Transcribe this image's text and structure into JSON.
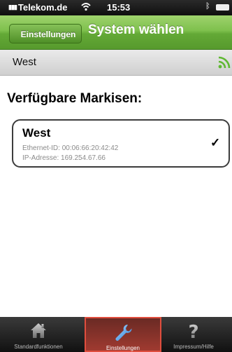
{
  "status_bar": {
    "carrier": "Telekom.de",
    "time": "15:53"
  },
  "nav": {
    "back_label": "Einstellungen",
    "title": "System wählen"
  },
  "selected_system": {
    "label": "West"
  },
  "section_heading": "Verfügbare Markisen:",
  "awnings": [
    {
      "name": "West",
      "ethernet_id": "Ethernet-ID: 00:06:66:20:42:42",
      "ip_address": "IP-Adresse: 169.254.67.66",
      "selected": true
    }
  ],
  "tabs": [
    {
      "label": "Standardfunktionen",
      "icon": "house-icon",
      "active": false
    },
    {
      "label": "Einstellungen",
      "icon": "wrench-icon",
      "active": true
    },
    {
      "label": "Impressum/Hilfe",
      "icon": "question-icon",
      "active": false
    }
  ],
  "colors": {
    "nav_green": "#63a936",
    "active_tab_red": "#e04e3e"
  }
}
